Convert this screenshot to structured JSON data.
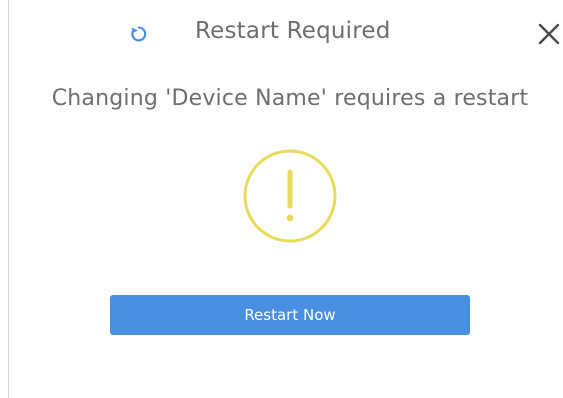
{
  "dialog": {
    "title": "Restart Required",
    "close_icon": "close-icon",
    "title_icon": "restart-icon",
    "message": "Changing 'Device Name' requires a restart",
    "warning_icon": "warning-exclamation-icon",
    "restart_button_label": "Restart Now"
  },
  "colors": {
    "accent": "#4a90e2",
    "warning": "#e6dc5a",
    "text": "#6e6e6e",
    "close": "#4a4a4a"
  }
}
